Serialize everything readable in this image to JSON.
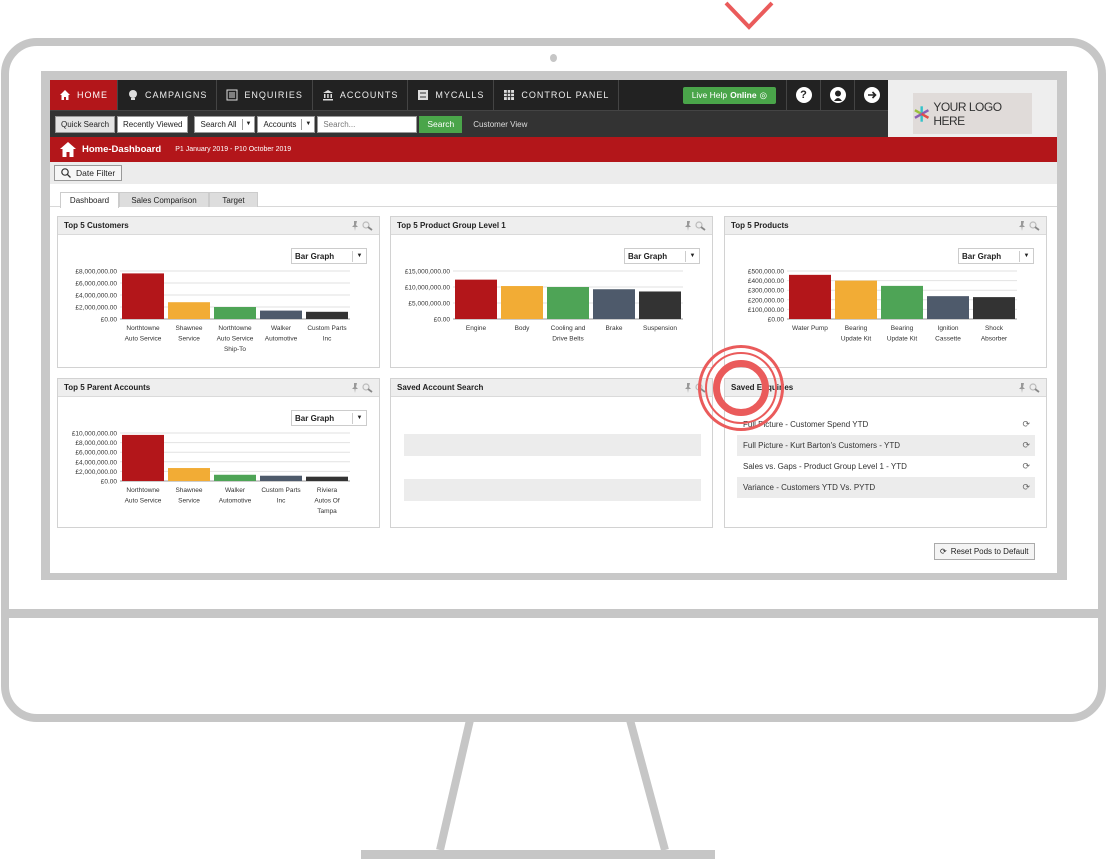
{
  "nav": {
    "items": [
      {
        "label": "HOME",
        "icon": "home-icon",
        "active": true
      },
      {
        "label": "CAMPAIGNS",
        "icon": "campaigns-icon",
        "active": false
      },
      {
        "label": "ENQUIRIES",
        "icon": "enquiries-icon",
        "active": false
      },
      {
        "label": "ACCOUNTS",
        "icon": "bank-icon",
        "active": false
      },
      {
        "label": "MYCALLS",
        "icon": "checklist-icon",
        "active": false
      },
      {
        "label": "CONTROL PANEL",
        "icon": "grid-icon",
        "active": false
      }
    ],
    "live_help_prefix": "Live Help",
    "live_help_status": "Online",
    "help_icon": "?",
    "logo_text": "YOUR LOGO HERE"
  },
  "searchbar": {
    "quick_search": "Quick Search",
    "recently_viewed": "Recently Viewed",
    "scope": "Search All",
    "entity": "Accounts",
    "placeholder": "Search...",
    "search_button": "Search",
    "customer_view": "Customer View"
  },
  "header": {
    "title": "Home-Dashboard",
    "date_range": "P1 January 2019 - P10 October 2019",
    "date_filter": "Date Filter"
  },
  "tabs": [
    "Dashboard",
    "Sales Comparison",
    "Target"
  ],
  "colors": {
    "brand_red": "#b3161a",
    "green": "#4aa54a",
    "bar_colors": [
      "#b3161a",
      "#f2ac35",
      "#4ea456",
      "#4e5a6b",
      "#333333"
    ]
  },
  "pods": {
    "top5_customers": {
      "title": "Top 5 Customers",
      "view": "Bar Graph"
    },
    "top5_product_group": {
      "title": "Top 5 Product Group Level 1",
      "view": "Bar Graph"
    },
    "top5_products": {
      "title": "Top 5 Products",
      "view": "Bar Graph"
    },
    "top5_parent_accounts": {
      "title": "Top 5 Parent Accounts",
      "view": "Bar Graph"
    },
    "saved_account_search": {
      "title": "Saved Account Search"
    },
    "saved_enquiries": {
      "title": "Saved Enquiries",
      "items": [
        "Full Picture - Customer Spend YTD",
        "Full Picture - Kurt Barton's Customers - YTD",
        "Sales vs. Gaps - Product Group Level 1 - YTD",
        "Variance - Customers YTD Vs. PYTD"
      ]
    }
  },
  "reset_button": "Reset Pods to Default",
  "chart_data": [
    {
      "id": "top5_customers",
      "type": "bar",
      "title": "Top 5 Customers",
      "categories": [
        [
          "Northtowne",
          "Auto Service"
        ],
        [
          "Shawnee",
          "Service"
        ],
        [
          "Northtowne",
          "Auto Service",
          "Ship-To"
        ],
        [
          "Walker",
          "Automotive"
        ],
        [
          "Custom Parts",
          "Inc"
        ]
      ],
      "values": [
        7600000,
        2800000,
        2000000,
        1400000,
        1200000
      ],
      "yticks": [
        "£0.00",
        "£2,000,000.00",
        "£4,000,000.00",
        "£6,000,000.00",
        "£8,000,000.00"
      ],
      "ylim": [
        0,
        8000000
      ],
      "grid": true
    },
    {
      "id": "top5_product_group",
      "type": "bar",
      "title": "Top 5 Product Group Level 1",
      "categories": [
        [
          "Engine"
        ],
        [
          "Body"
        ],
        [
          "Cooling and",
          "Drive Belts"
        ],
        [
          "Brake"
        ],
        [
          "Suspension"
        ]
      ],
      "values": [
        12300000,
        10300000,
        10000000,
        9300000,
        8600000
      ],
      "yticks": [
        "£0.00",
        "£5,000,000.00",
        "£10,000,000.00",
        "£15,000,000.00"
      ],
      "ylim": [
        0,
        15000000
      ],
      "grid": true
    },
    {
      "id": "top5_products",
      "type": "bar",
      "title": "Top 5 Products",
      "categories": [
        [
          "Water Pump"
        ],
        [
          "Bearing",
          "Update Kit"
        ],
        [
          "Bearing",
          "Update Kit"
        ],
        [
          "Ignition",
          "Cassette"
        ],
        [
          "Shock",
          "Absorber"
        ]
      ],
      "values": [
        460000,
        400000,
        345000,
        238000,
        228000
      ],
      "yticks": [
        "£0.00",
        "£100,000.00",
        "£200,000.00",
        "£300,000.00",
        "£400,000.00",
        "£500,000.00"
      ],
      "ylim": [
        0,
        500000
      ],
      "grid": true
    },
    {
      "id": "top5_parent_accounts",
      "type": "bar",
      "title": "Top 5 Parent Accounts",
      "categories": [
        [
          "Northtowne",
          "Auto Service"
        ],
        [
          "Shawnee",
          "Service"
        ],
        [
          "Walker",
          "Automotive"
        ],
        [
          "Custom Parts",
          "Inc"
        ],
        [
          "Riviera",
          "Autos Of",
          "Tampa"
        ]
      ],
      "values": [
        9600000,
        2700000,
        1300000,
        1100000,
        900000
      ],
      "yticks": [
        "£0.00",
        "£2,000,000.00",
        "£4,000,000.00",
        "£6,000,000.00",
        "£8,000,000.00",
        "£10,000,000.00"
      ],
      "ylim": [
        0,
        10000000
      ],
      "grid": true
    }
  ]
}
